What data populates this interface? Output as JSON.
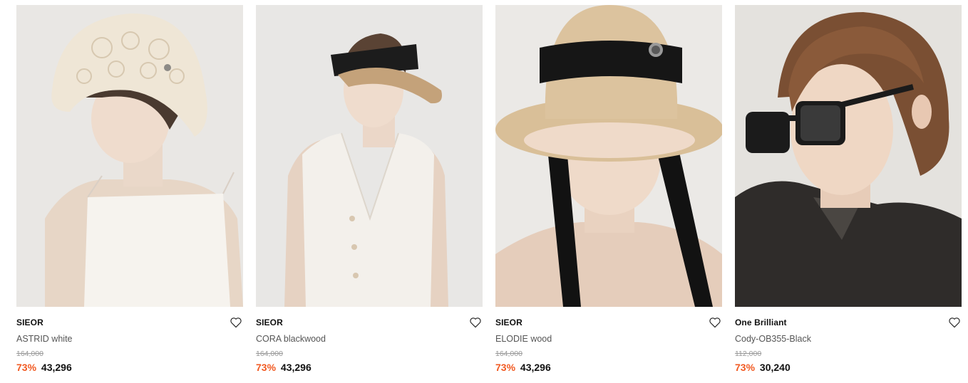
{
  "products": [
    {
      "brand": "SIEOR",
      "name": "ASTRID white",
      "original_price": "164,000",
      "discount": "73%",
      "price": "43,296",
      "image": "model-crochet-bucket-hat",
      "wishlist_icon": "heart-outline-icon"
    },
    {
      "brand": "SIEOR",
      "name": "CORA blackwood",
      "original_price": "164,000",
      "discount": "73%",
      "price": "43,296",
      "image": "model-straw-visor",
      "wishlist_icon": "heart-outline-icon"
    },
    {
      "brand": "SIEOR",
      "name": "ELODIE wood",
      "original_price": "164,000",
      "discount": "73%",
      "price": "43,296",
      "image": "model-straw-wide-brim-hat",
      "wishlist_icon": "heart-outline-icon"
    },
    {
      "brand": "One Brilliant",
      "name": "Cody-OB355-Black",
      "original_price": "112,000",
      "discount": "73%",
      "price": "30,240",
      "image": "model-black-sunglasses",
      "wishlist_icon": "heart-outline-icon"
    }
  ],
  "colors": {
    "discount": "#f15a22",
    "text": "#111111",
    "muted": "#999999"
  }
}
